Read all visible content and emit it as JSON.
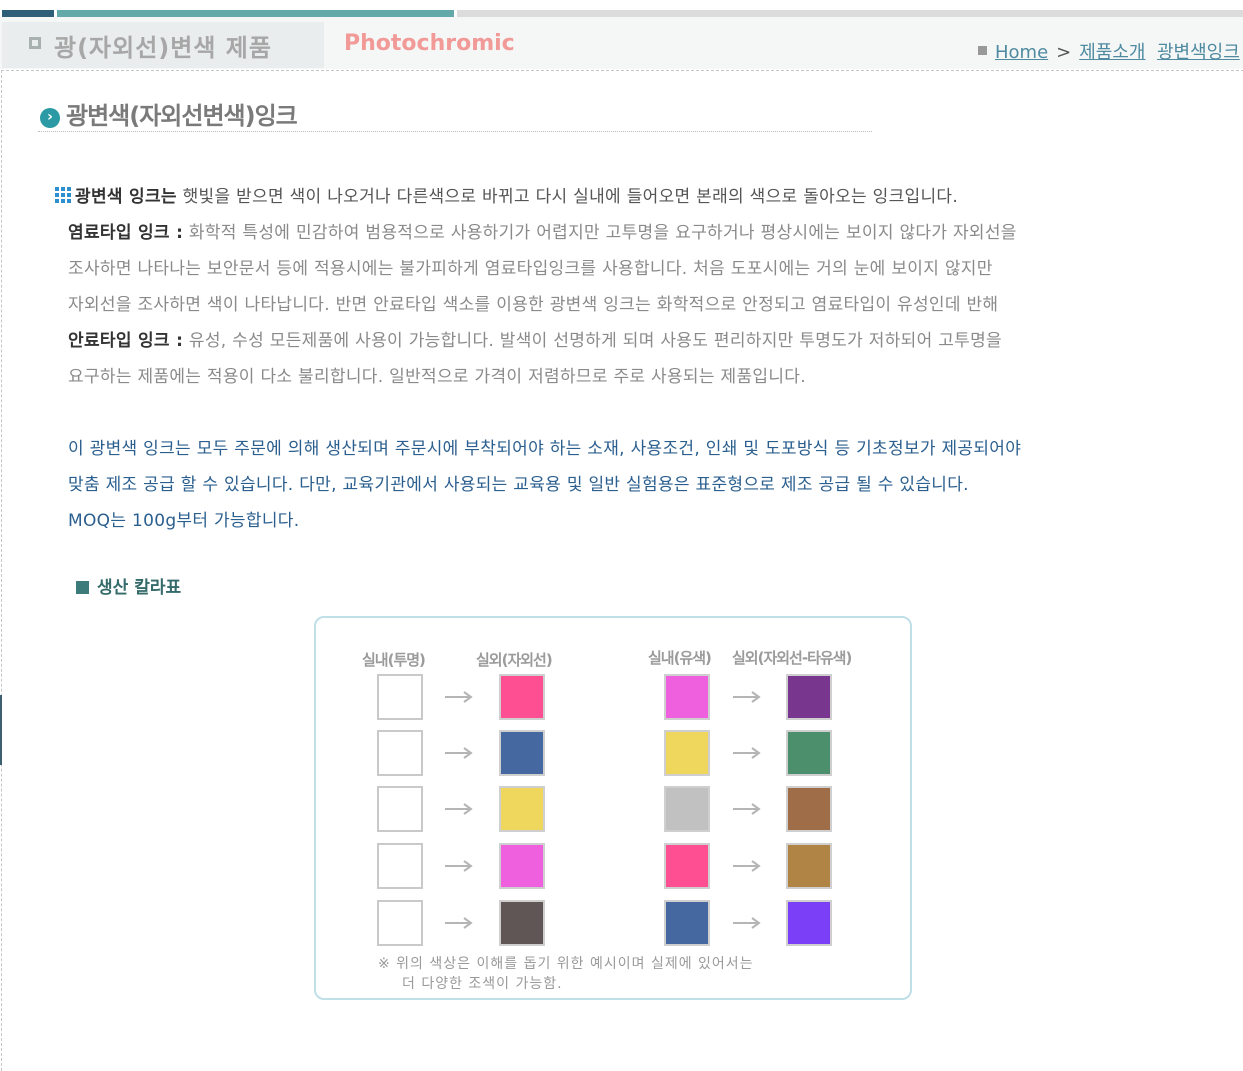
{
  "header": {
    "title": "광(자외선)변색  제품",
    "title_en": "Photochromic",
    "breadcrumb": [
      "Home",
      "제품소개",
      "광변색잉크"
    ],
    "breadcrumb_sep": ">"
  },
  "section": {
    "title": "광변색(자외선변색)잉크"
  },
  "body": {
    "lead_bold": "광변색 잉크는",
    "lead_rest": " 햇빛을 받으면 색이 나오거나 다른색으로 바뀌고 다시 실내에 들어오면 본래의 색으로 돌아오는 잉크입니다.",
    "dye_label": "염료타입 잉크 :",
    "dye_line1": " 화학적 특성에 민감하여 범용적으로 사용하기가 어렵지만 고투명을 요구하거나 평상시에는 보이지 않다가 자외선을",
    "dye_line2": "조사하면 나타나는 보안문서 등에 적용시에는 불가피하게 염료타입잉크를 사용합니다.  처음 도포시에는 거의 눈에 보이지 않지만",
    "dye_line3": "자외선을 조사하면 색이 나타납니다.   반면 안료타입 색소를 이용한 광변색 잉크는 화학적으로 안정되고 염료타입이 유성인데 반해",
    "pig_label": "안료타입 잉크 :",
    "pig_line1": "  유성, 수성 모든제품에 사용이 가능합니다.   발색이 선명하게 되며 사용도 편리하지만 투명도가 저하되어 고투명을",
    "pig_line2": "요구하는 제품에는 적용이 다소 불리합니다.  일반적으로 가격이 저렴하므로 주로 사용되는 제품입니다.",
    "order_line1": "이 광변색 잉크는 모두 주문에 의해 생산되며 주문시에 부착되어야 하는 소재, 사용조건, 인쇄 및 도포방식 등 기초정보가 제공되어야",
    "order_line2": "맞춤 제조 공급 할 수 있습니다.  다만, 교육기관에서 사용되는 교육용 및 일반 실험용은 표준형으로 제조 공급 될 수 있습니다.",
    "order_line3": "MOQ는 100g부터 가능합니다."
  },
  "color_table": {
    "title": "생산 칼라표",
    "headers": [
      "실내(투명)",
      "실외(자외선)",
      "실내(유색)",
      "실외(자외선-타유색)"
    ],
    "transparent_rows": [
      "#ff4f93",
      "#44689f",
      "#efd75e",
      "#ee60dd",
      "#615656"
    ],
    "colored_rows": [
      {
        "indoor": "#ee60dd",
        "outdoor": "#78368f"
      },
      {
        "indoor": "#efd75e",
        "outdoor": "#4b8f6d"
      },
      {
        "indoor": "#c1c1c1",
        "outdoor": "#9f6e48"
      },
      {
        "indoor": "#ff4f93",
        "outdoor": "#b08445"
      },
      {
        "indoor": "#44689f",
        "outdoor": "#7a3ff6"
      }
    ],
    "note_line1": "※  위의 색상은 이해를 돕기 위한 예시이며 실제에 있어서는",
    "note_line2": "더 다양한 조색이 가능함."
  },
  "colors": {
    "accent_teal": "#63a9a9",
    "accent_navy": "#2f5f78",
    "pink": "#f19a98",
    "link": "#4e8aa0",
    "body_blue": "#2b5f8f"
  }
}
